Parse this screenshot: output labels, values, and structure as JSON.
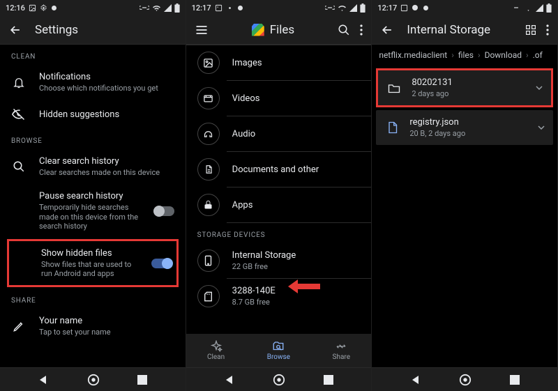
{
  "panel1": {
    "status": {
      "time": "12:16",
      "icons": [
        "image",
        "gear",
        "circle"
      ],
      "right": [
        "link",
        "wifi",
        "signal",
        "battery"
      ]
    },
    "title": "Settings",
    "sections": {
      "clean_label": "CLEAN",
      "browse_label": "BROWSE",
      "share_label": "SHARE"
    },
    "items": {
      "notifications": {
        "title": "Notifications",
        "sub": "Choose which notifications you get"
      },
      "hidden_suggestions": {
        "title": "Hidden suggestions"
      },
      "clear_history": {
        "title": "Clear search history",
        "sub": "Clear searches made on this device"
      },
      "pause_history": {
        "title": "Pause search history",
        "sub": "Temporarily hide searches made on this device from the search history"
      },
      "show_hidden": {
        "title": "Show hidden files",
        "sub": "Show files that are used to run Android and apps"
      },
      "your_name": {
        "title": "Your name",
        "sub": "Tap to set your name"
      }
    }
  },
  "panel2": {
    "status": {
      "time": "12:17"
    },
    "title": "Files",
    "categories": {
      "images": "Images",
      "videos": "Videos",
      "audio": "Audio",
      "documents": "Documents and other",
      "apps": "Apps"
    },
    "storage_label": "STORAGE DEVICES",
    "storage": {
      "internal": {
        "title": "Internal Storage",
        "sub": "22 GB free"
      },
      "sd": {
        "title": "3288-140E",
        "sub": "8.7 GB free"
      }
    },
    "nav": {
      "clean": "Clean",
      "browse": "Browse",
      "share": "Share"
    }
  },
  "panel3": {
    "status": {
      "time": "12:17"
    },
    "title": "Internal Storage",
    "crumbs": [
      "netflix.mediaclient",
      "files",
      "Download",
      ".of"
    ],
    "files": {
      "folder": {
        "title": "80202131",
        "sub": "2 days ago"
      },
      "registry": {
        "title": "registry.json",
        "sub": "20 B, 2 days ago"
      }
    }
  }
}
